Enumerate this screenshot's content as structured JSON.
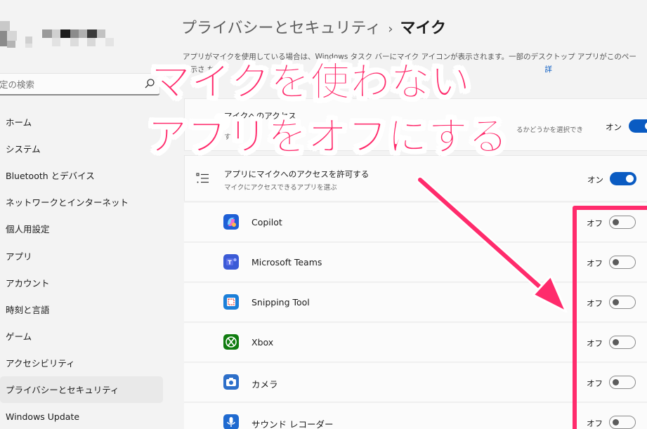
{
  "sidebar": {
    "search": {
      "value": "",
      "placeholder": "定の検索"
    },
    "items": [
      {
        "label": "ホーム",
        "active": false
      },
      {
        "label": "システム",
        "active": false
      },
      {
        "label": "Bluetooth とデバイス",
        "active": false
      },
      {
        "label": "ネットワークとインターネット",
        "active": false
      },
      {
        "label": "個人用設定",
        "active": false
      },
      {
        "label": "アプリ",
        "active": false
      },
      {
        "label": "アカウント",
        "active": false
      },
      {
        "label": "時刻と言語",
        "active": false
      },
      {
        "label": "ゲーム",
        "active": false
      },
      {
        "label": "アクセシビリティ",
        "active": false
      },
      {
        "label": "プライバシーとセキュリティ",
        "active": true
      },
      {
        "label": "Windows Update",
        "active": false
      }
    ]
  },
  "header": {
    "parent": "プライバシーとセキュリティ",
    "separator": "›",
    "current": "マイク"
  },
  "description": {
    "line1": "アプリがマイクを使用している場合は、Windows タスク バーにマイク アイコンが表示されます。一部のデスクトップ アプリがこのペー",
    "line2": "表示さ     か",
    "link": "詳"
  },
  "mic_access": {
    "title": "マイクへのアクセス",
    "subtitle": "す",
    "right_note": "るかどうかを選択でき",
    "state": "オン"
  },
  "apps_access": {
    "title": "アプリにマイクへのアクセスを許可する",
    "subtitle": "マイクにアクセスできるアプリを選ぶ",
    "state": "オン"
  },
  "apps": [
    {
      "name": "Copilot",
      "state": "オフ",
      "icon": "copilot-icon"
    },
    {
      "name": "Microsoft Teams",
      "state": "オフ",
      "icon": "teams-icon"
    },
    {
      "name": "Snipping Tool",
      "state": "オフ",
      "icon": "snipping-tool-icon"
    },
    {
      "name": "Xbox",
      "state": "オフ",
      "icon": "xbox-icon"
    },
    {
      "name": "カメラ",
      "state": "オフ",
      "icon": "camera-icon"
    },
    {
      "name": "サウンド レコーダー",
      "state": "オフ",
      "icon": "sound-recorder-icon"
    }
  ],
  "overlay": {
    "line1": "マイクを使わない",
    "line2": "アプリをオフにする",
    "color": "#ff2b6c"
  },
  "colors": {
    "accent": "#0a5bc2",
    "annotation": "#ff2b6c"
  }
}
